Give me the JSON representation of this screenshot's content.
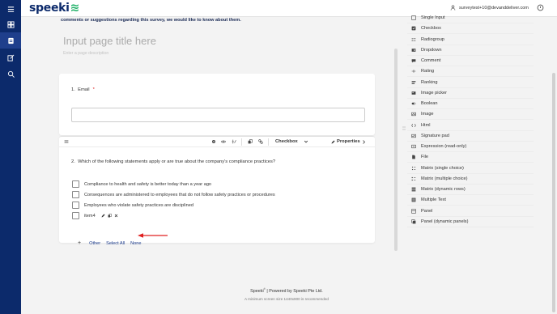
{
  "brand": {
    "logo_text": "speeki",
    "accent": "#0c2a6b",
    "green": "#25b36b"
  },
  "rail": {
    "items": [
      {
        "name": "menu-icon"
      },
      {
        "name": "dashboard-icon"
      },
      {
        "name": "survey-icon"
      },
      {
        "name": "edit-icon"
      },
      {
        "name": "search-icon"
      }
    ]
  },
  "header": {
    "user_email": "surveytest+10@devanddeliver.com"
  },
  "editor": {
    "description_text": "comments or suggestions regarding this survey, we would like to know about them.",
    "page_title_placeholder": "Input page title here",
    "page_desc_placeholder": "Enter a page description",
    "q1": {
      "number": "1.",
      "title": "Email",
      "required_mark": "*"
    },
    "q2": {
      "number": "2.",
      "title": "Which of the following statements apply or are true about the company's compliance practices?",
      "type_label": "Checkbox",
      "properties_label": "Properties",
      "choices": [
        "Compliance to health and safety is better today than a year ago",
        "Consequences are administered to employees that do not follow safety practices or procedures",
        "Employees who violate safety practices are disciplined",
        "item4"
      ],
      "add_other": "Other",
      "add_select_all": "Select All",
      "add_none": "None"
    }
  },
  "toolbox": {
    "items": [
      {
        "label": "Single Input",
        "icon": "single-input-icon"
      },
      {
        "label": "Checkbox",
        "icon": "checkbox-icon"
      },
      {
        "label": "Radiogroup",
        "icon": "radiogroup-icon"
      },
      {
        "label": "Dropdown",
        "icon": "dropdown-icon"
      },
      {
        "label": "Comment",
        "icon": "comment-icon"
      },
      {
        "label": "Rating",
        "icon": "rating-icon"
      },
      {
        "label": "Ranking",
        "icon": "ranking-icon"
      },
      {
        "label": "Image picker",
        "icon": "image-picker-icon"
      },
      {
        "label": "Boolean",
        "icon": "boolean-icon"
      },
      {
        "label": "Image",
        "icon": "image-icon"
      },
      {
        "label": "Html",
        "icon": "html-icon"
      },
      {
        "label": "Signature pad",
        "icon": "signature-pad-icon"
      },
      {
        "label": "Expression (read-only)",
        "icon": "expression-icon"
      },
      {
        "label": "File",
        "icon": "file-icon"
      },
      {
        "label": "Matrix (single choice)",
        "icon": "matrix-single-icon"
      },
      {
        "label": "Matrix (multiple choice)",
        "icon": "matrix-multiple-icon"
      },
      {
        "label": "Matrix (dynamic rows)",
        "icon": "matrix-dynamic-icon"
      },
      {
        "label": "Multiple Text",
        "icon": "multiple-text-icon"
      },
      {
        "label": "Panel",
        "icon": "panel-icon"
      },
      {
        "label": "Panel (dynamic panels)",
        "icon": "panel-dynamic-icon"
      }
    ]
  },
  "footer": {
    "line1_brand": "Speeki",
    "line1_sep": "|",
    "line1_rest": "Powered by Speeki Pte Ltd.",
    "line2": "A minimum screen size 1440x900 is recommended"
  },
  "colors": {
    "arrow": "#e02020",
    "link": "#1a3a8c"
  }
}
